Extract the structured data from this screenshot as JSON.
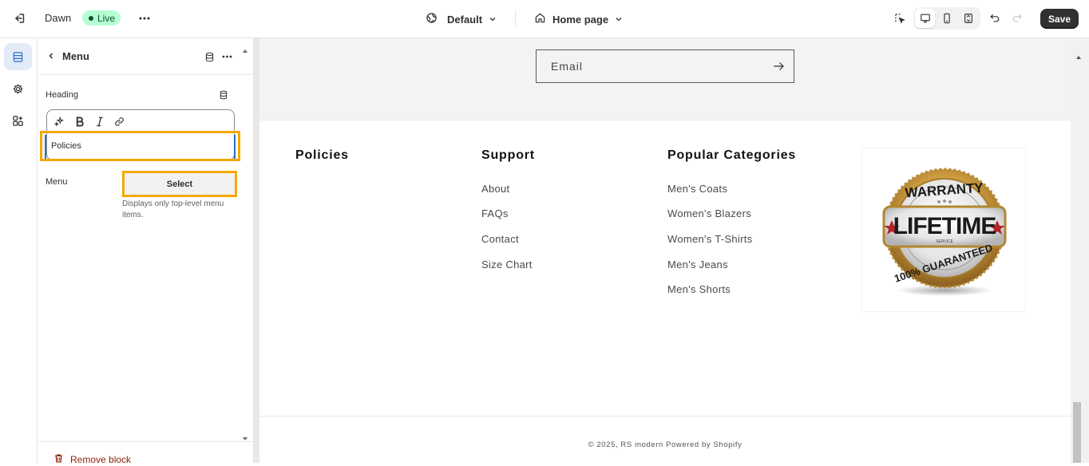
{
  "topbar": {
    "theme_name": "Dawn",
    "status_badge": "Live",
    "theme_dropdown": "Default",
    "page_dropdown": "Home page",
    "save_label": "Save"
  },
  "panel": {
    "title": "Menu",
    "heading_label": "Heading",
    "heading_value": "Policies",
    "menu_label": "Menu",
    "menu_button": "Select",
    "menu_help": "Displays only top-level menu items.",
    "remove_label": "Remove block"
  },
  "preview": {
    "email_placeholder": "Email",
    "columns": [
      {
        "heading": "Policies",
        "links": []
      },
      {
        "heading": "Support",
        "links": [
          "About",
          "FAQs",
          "Contact",
          "Size Chart"
        ]
      },
      {
        "heading": "Popular Categories",
        "links": [
          "Men's Coats",
          "Women's Blazers",
          "Women's T-Shirts",
          "Men's Jeans",
          "Men's Shorts"
        ]
      }
    ],
    "badge": {
      "top_text": "WARRANTY",
      "main_text": "LIFETIME",
      "small_text": "SERVICE",
      "bottom_text": "100% GUARANTEED"
    },
    "copyright": "© 2025, RS modern Powered by Shopify"
  },
  "colors": {
    "accent_highlight": "#f5a800",
    "live_badge_bg": "#b4fed2",
    "save_bg": "#303030",
    "remove_red": "#8e1f0b"
  }
}
